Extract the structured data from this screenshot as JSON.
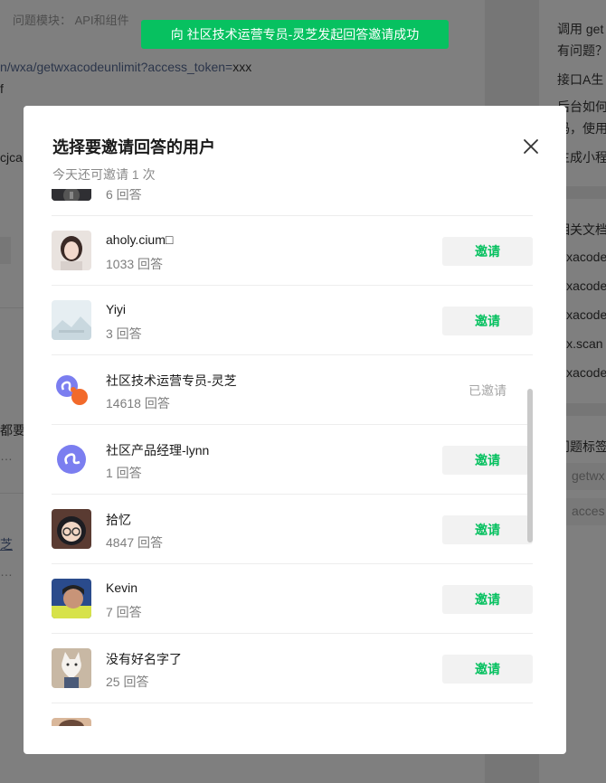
{
  "background": {
    "module_label": "问题模块：",
    "module_value": "API和组件",
    "api_path": "n/wxa/getwxacodeunlimit?access_token=",
    "api_token": "xxx",
    "snippet_1": "f",
    "snippet_2": "cjca",
    "snippet_3": "都要",
    "snippet_4": "…",
    "snippet_5": "芝",
    "snippet_6": "…",
    "right_1": "调用 get",
    "right_2": "有问题？",
    "right_3": "接口A生",
    "right_4": "后台如何",
    "right_5": "码，使用",
    "right_6": "生成小程",
    "right_related": "相关文档",
    "right_doc_1": "wxacode",
    "right_doc_2": "wxacode",
    "right_doc_3": "wxacode",
    "right_doc_4": "wx.scan",
    "right_doc_5": "wxacode",
    "right_tags": "问题标签",
    "tag_1": "getwx",
    "tag_2": "acces"
  },
  "toast": {
    "text": "向 社区技术运营专员-灵芝发起回答邀请成功"
  },
  "dialog": {
    "title": "选择要邀请回答的用户",
    "subtitle": "今天还可邀请 1 次",
    "close_icon": "close-icon"
  },
  "users": [
    {
      "name": "",
      "count": "6 回答",
      "button": "",
      "invited": false,
      "avatar": "photo-dark"
    },
    {
      "name": "aholy.cium□",
      "count": "1033 回答",
      "button": "邀请",
      "invited": false,
      "avatar": "photo-girl"
    },
    {
      "name": "Yiyi",
      "count": "3 回答",
      "button": "邀请",
      "invited": false,
      "avatar": "landscape-placeholder"
    },
    {
      "name": "社区技术运营专员-灵芝",
      "count": "14618 回答",
      "button": "已邀请",
      "invited": true,
      "avatar": "miniprogram-logo-orange"
    },
    {
      "name": "社区产品经理-lynn",
      "count": "1 回答",
      "button": "邀请",
      "invited": false,
      "avatar": "miniprogram-logo"
    },
    {
      "name": "拾忆",
      "count": "4847 回答",
      "button": "邀请",
      "invited": false,
      "avatar": "anime-boy"
    },
    {
      "name": "Kevin",
      "count": "7 回答",
      "button": "邀请",
      "invited": false,
      "avatar": "photo-child"
    },
    {
      "name": "没有好名字了",
      "count": "25 回答",
      "button": "邀请",
      "invited": false,
      "avatar": "cartoon-cat"
    },
    {
      "name": "",
      "count": "",
      "button": "",
      "invited": false,
      "avatar": "photo-partial"
    }
  ],
  "colors": {
    "accent": "#07c160",
    "button_bg": "#f2f2f2",
    "invited_text": "#a6a6a6"
  }
}
